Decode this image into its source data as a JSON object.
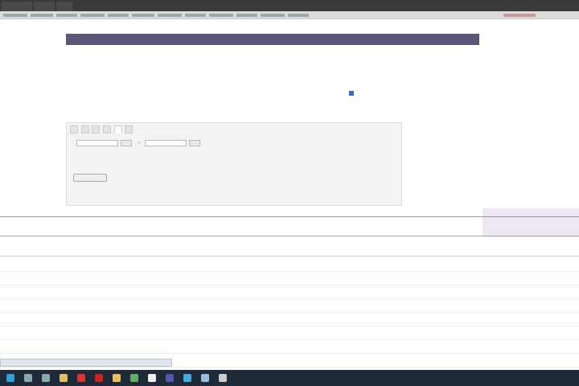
{
  "browser": {
    "tabs": [
      "",
      "",
      ""
    ],
    "bookmarks": [
      "",
      "",
      "",
      "",
      "",
      "",
      "",
      "",
      "",
      "",
      "",
      ""
    ],
    "topright": ""
  },
  "sidebar": {
    "logo": "",
    "links": [
      "",
      ""
    ]
  },
  "topnav": [
    "",
    "",
    "",
    "",
    "",
    "",
    "",
    "",
    ""
  ],
  "banner": "",
  "toolbar": {
    "left": [
      "",
      ""
    ],
    "right": [
      "",
      "",
      "",
      "",
      ""
    ]
  },
  "title": "",
  "meta": {
    "label1": "",
    "value1": "",
    "label2": "",
    "value2": "",
    "label3": "",
    "value3": "",
    "link3": ""
  },
  "checkbox_label": "",
  "filter": {
    "tabs": [
      "",
      "",
      "",
      "",
      "",
      ""
    ],
    "date_label": "",
    "date_from": "",
    "date_to": "",
    "presets": [
      "",
      "",
      "",
      "",
      "",
      ""
    ],
    "hint": "",
    "submit": ""
  },
  "table": {
    "headers": [
      "",
      "",
      "",
      "",
      "",
      "",
      "",
      "",
      "",
      ""
    ],
    "total": [
      "",
      "",
      "",
      "",
      "",
      "",
      "",
      "",
      "",
      ""
    ],
    "sub": [
      "",
      "",
      "",
      "",
      "",
      "",
      "",
      ""
    ],
    "rows": [
      {
        "name": "",
        "vals": [
          "",
          "",
          "",
          "",
          "",
          "",
          "",
          ""
        ]
      },
      {
        "name": "",
        "vals": [
          "",
          "",
          "",
          "",
          "",
          "",
          "",
          ""
        ]
      },
      {
        "name": "",
        "vals": [
          "",
          "",
          "",
          "",
          "",
          "",
          "",
          ""
        ]
      },
      {
        "name": "",
        "vals": [
          "",
          "",
          "",
          "",
          "",
          "",
          "",
          ""
        ]
      },
      {
        "name": "",
        "vals": [
          "",
          "",
          "",
          "",
          "",
          "",
          "",
          ""
        ]
      },
      {
        "name": "",
        "vals": [
          "",
          "",
          "",
          "",
          "",
          "",
          "",
          ""
        ]
      },
      {
        "name": "",
        "vals": [
          "",
          "",
          "",
          "",
          "",
          "",
          "",
          ""
        ]
      },
      {
        "name": "",
        "vals": [
          "",
          "",
          "",
          "",
          "",
          "",
          "",
          ""
        ]
      }
    ]
  },
  "status_tip": "",
  "taskbar": {
    "icons": [
      "start-icon",
      "search-icon",
      "task-view-icon",
      "explorer-icon",
      "chrome-icon",
      "opera-icon",
      "folder-icon",
      "app-icon",
      "app-icon-2",
      "app-icon-3",
      "app-icon-4",
      "app-icon-5",
      "app-icon-6"
    ],
    "colors": [
      "#2f9fd8",
      "#8aa",
      "#8aa",
      "#e0c060",
      "#d33",
      "#c22",
      "#e8c060",
      "#6a6",
      "#eee",
      "#55a",
      "#4ad",
      "#9bd",
      "#ccc"
    ],
    "clock": ""
  }
}
